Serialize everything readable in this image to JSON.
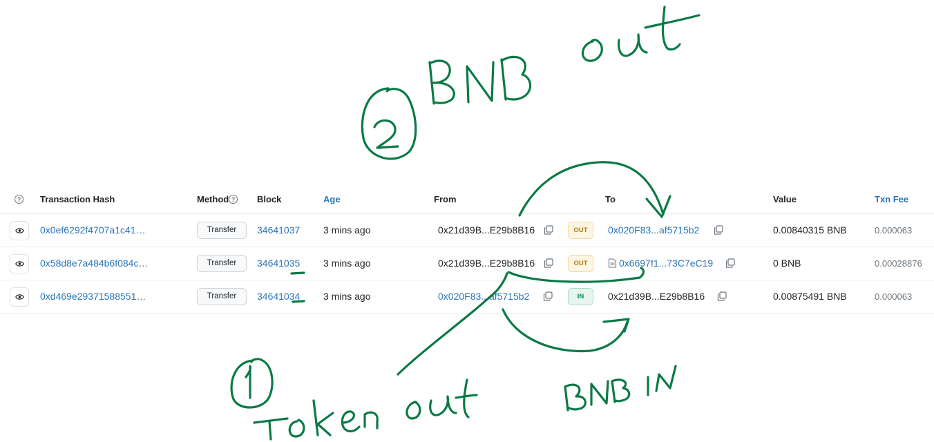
{
  "table": {
    "headers": {
      "tx_hash": "Transaction Hash",
      "method": "Method",
      "block": "Block",
      "age": "Age",
      "from": "From",
      "to": "To",
      "value": "Value",
      "txn_fee": "Txn Fee"
    },
    "rows": [
      {
        "tx_hash": "0x0ef6292f4707a1c41…",
        "method": "Transfer",
        "block": "34641037",
        "age": "3 mins ago",
        "from": "0x21d39B...E29b8B16",
        "direction": "OUT",
        "to": "0x020F83...af5715b2",
        "value": "0.00840315 BNB",
        "fee": "0.000063"
      },
      {
        "tx_hash": "0x58d8e7a484b6f084c…",
        "method": "Transfer",
        "block": "34641035",
        "age": "3 mins ago",
        "from": "0x21d39B...E29b8B16",
        "direction": "OUT",
        "to": "0x6697f1...73C7eC19",
        "value": "0 BNB",
        "fee": "0.00028876"
      },
      {
        "tx_hash": "0xd469e29371588551…",
        "method": "Transfer",
        "block": "34641034",
        "age": "3 mins ago",
        "from": "0x020F83...af5715b2",
        "direction": "IN",
        "to": "0x21d39B...E29b8B16",
        "value": "0.00875491 BNB",
        "fee": "0.000063"
      }
    ]
  },
  "annotations": {
    "circle_2": "2",
    "bnb_out": "BNB out",
    "circle_1": "1",
    "token_out": "Token out",
    "bnb_in": "BNB IN"
  },
  "colors": {
    "link": "#2a76b8",
    "annotation_ink": "#0a7a45",
    "out_badge_bg": "#fef6e4",
    "in_badge_bg": "#e7f5ef"
  }
}
